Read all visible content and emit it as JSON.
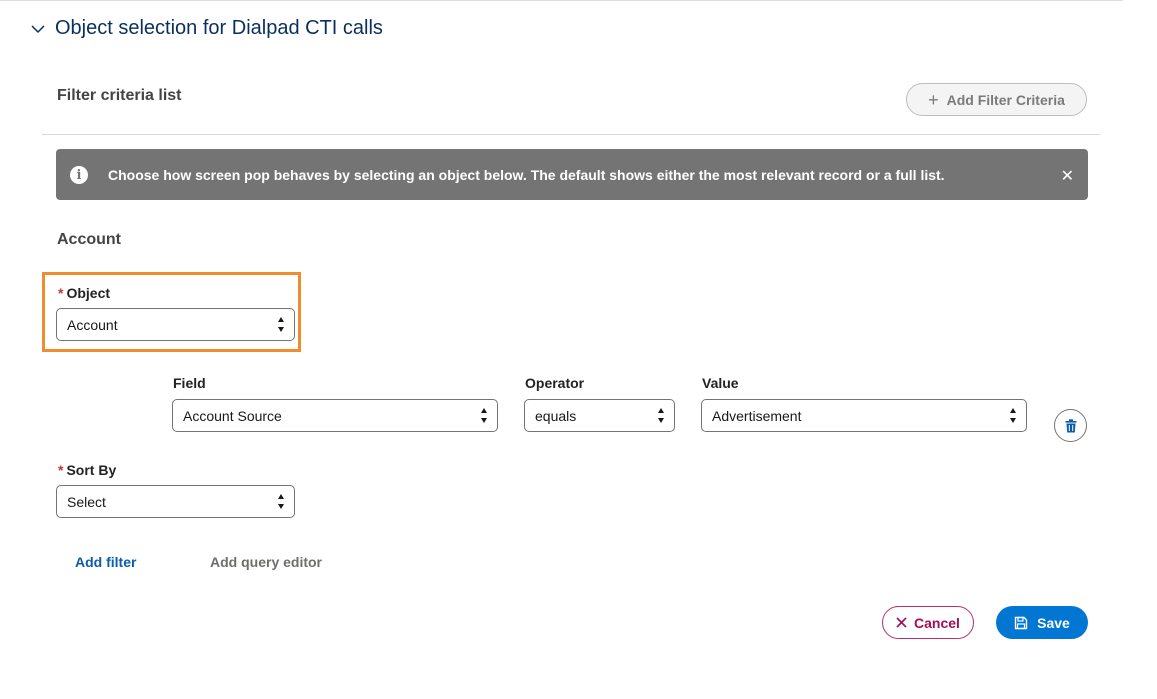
{
  "section": {
    "title": "Object selection for Dialpad CTI calls",
    "toggle_icon": "chevron-down-icon"
  },
  "filter_criteria": {
    "title": "Filter criteria list",
    "add_button_label": "Add Filter Criteria",
    "add_icon": "plus-icon"
  },
  "banner": {
    "icon": "info-icon",
    "message": "Choose how screen pop behaves by selecting an object below. The default shows either the most relevant record or a full list.",
    "close_icon": "close-icon"
  },
  "criteria": {
    "heading": "Account",
    "object": {
      "label": "Object",
      "required": true,
      "value": "Account"
    },
    "condition": {
      "field": {
        "label": "Field",
        "value": "Account Source"
      },
      "operator": {
        "label": "Operator",
        "value": "equals"
      },
      "value": {
        "label": "Value",
        "value": "Advertisement"
      },
      "delete_icon": "trash-icon"
    },
    "sort_by": {
      "label": "Sort By",
      "required": true,
      "value": "Select"
    }
  },
  "links": {
    "add_filter": "Add filter",
    "add_query_editor": "Add query editor"
  },
  "actions": {
    "cancel_label": "Cancel",
    "save_label": "Save"
  },
  "colors": {
    "accent": "#0176d3",
    "highlight": "#f08c2e",
    "cancel": "#a30e57",
    "banner": "#747474",
    "required": "#c23934"
  }
}
